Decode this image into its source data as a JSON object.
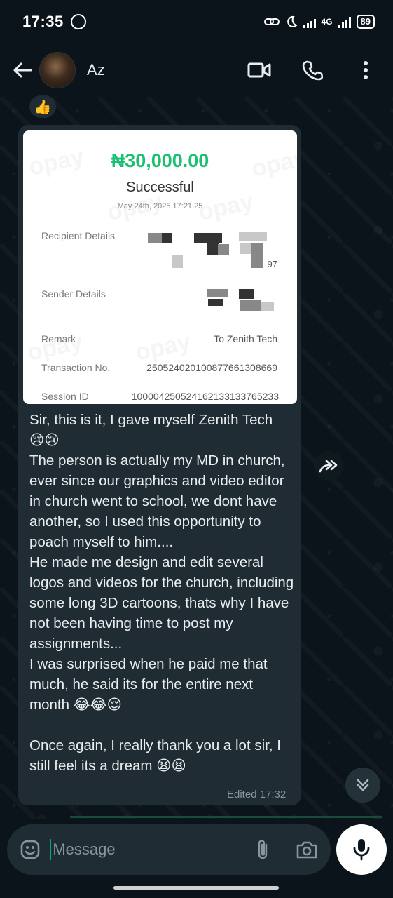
{
  "status_bar": {
    "time": "17:35",
    "network": "4G",
    "battery": "89"
  },
  "header": {
    "contact_name": "Az",
    "icons": [
      "back-arrow-icon",
      "video-call-icon",
      "phone-icon",
      "more-vert-icon"
    ]
  },
  "reaction": "👍",
  "receipt": {
    "amount": "₦30,000.00",
    "status": "Successful",
    "datetime": "May 24th, 2025 17:21:25",
    "recipient_label": "Recipient Details",
    "recipient_tail": "97",
    "sender_label": "Sender Details",
    "remark_label": "Remark",
    "remark_value": "To Zenith Tech",
    "transaction_label": "Transaction No.",
    "transaction_value": "250524020100877661308669",
    "session_label": "Session ID",
    "session_value": "100004250524162133133765233",
    "watermark": "opay"
  },
  "message": {
    "text": "Sir, this is it, I gave myself Zenith Tech\n😢😢\nThe person is actually my MD in church, ever since our graphics and video editor in church went to school, we dont have another, so I used this opportunity to poach myself to him....\nHe made me design and edit several logos and videos for the church, including some long 3D cartoons, thats why I have not been having time to post my assignments...\nI was surprised when he paid me that much, he said its for the entire next month 😂😂😌\n\nOnce again, I really thank you a lot sir, I still feel its a dream 😫😫",
    "meta": "Edited 17:32"
  },
  "input": {
    "placeholder": "Message"
  },
  "colors": {
    "background": "#0b141a",
    "bubble": "#1f2c34",
    "accent": "#00a884",
    "amount_green": "#1dbf73",
    "text_secondary": "#8696a0"
  }
}
